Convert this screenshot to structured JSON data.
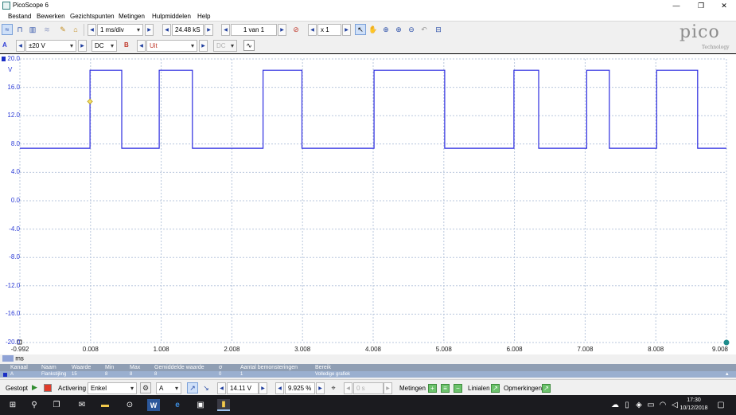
{
  "window": {
    "title": "PicoScope 6",
    "minimize": "—",
    "maximize": "❐",
    "close": "✕"
  },
  "menu": [
    "Bestand",
    "Bewerken",
    "Gezichtspunten",
    "Metingen",
    "Hulpmiddelen",
    "Help"
  ],
  "toolbar1": {
    "timebase": "1 ms/div",
    "samples": "24.48 kS",
    "capture": "1 van 1",
    "zoom": "x 1"
  },
  "toolbar2": {
    "channel_a_label": "A",
    "channel_a_range": "±20 V",
    "channel_a_coupling": "DC",
    "channel_b_label": "B",
    "channel_b_range": "Uit",
    "channel_b_coupling": "DC"
  },
  "logo": {
    "text": "pico",
    "subtext": "Technology"
  },
  "chart_data": {
    "type": "line",
    "ylabel": "V",
    "xlabel": "ms",
    "ylim": [
      -20,
      20
    ],
    "xlim": [
      -0.992,
      9.008
    ],
    "yticks": [
      "20.0",
      "16.0",
      "12.0",
      "8.0",
      "4.0",
      "0.0",
      "-4.0",
      "-8.0",
      "-12.0",
      "-16.0",
      "-20.0"
    ],
    "xticks": [
      "-0.992",
      "0.008",
      "1.008",
      "2.008",
      "3.008",
      "4.008",
      "5.008",
      "6.008",
      "7.008",
      "8.008",
      "9.008"
    ],
    "grid": true,
    "series": [
      {
        "name": "A",
        "color": "#2c2ce0",
        "x": [
          -0.992,
          0.0,
          0.0,
          0.45,
          0.45,
          0.98,
          0.98,
          1.45,
          1.45,
          2.45,
          2.45,
          3.0,
          3.0,
          4.02,
          4.02,
          5.02,
          5.02,
          6.0,
          6.0,
          6.35,
          6.35,
          7.03,
          7.03,
          7.35,
          7.35,
          8.02,
          8.02,
          8.6,
          8.6,
          9.008
        ],
        "y": [
          7.4,
          7.4,
          18.4,
          18.4,
          7.4,
          7.4,
          18.4,
          18.4,
          7.4,
          7.4,
          18.4,
          18.4,
          7.4,
          7.4,
          18.4,
          18.4,
          7.4,
          7.4,
          18.4,
          18.4,
          7.4,
          7.4,
          18.4,
          18.4,
          7.4,
          7.4,
          18.4,
          18.4,
          7.4,
          7.4
        ]
      }
    ],
    "trigger": {
      "x": 0.0,
      "y": 14.0
    }
  },
  "measurements": {
    "headers": [
      "Kanaal",
      "Naam",
      "Waarde",
      "Min",
      "Max",
      "Gemiddelde waarde",
      "σ",
      "Aantal bemonsteringen",
      "Bereik"
    ],
    "row": [
      "A",
      "Flankstijling",
      "15",
      "8",
      "8",
      "8",
      "0",
      "1",
      "Volledige grafiek"
    ]
  },
  "bottombar": {
    "status": "Gestopt",
    "trigger_label": "Activering",
    "trigger_mode": "Enkel",
    "trigger_channel": "A",
    "trigger_level": "14.11 V",
    "pre_trigger": "9.925 %",
    "delay": "0 s",
    "measurements_label": "Metingen",
    "rulers_label": "Linialen",
    "notes_label": "Opmerkingen"
  },
  "taskbar": {
    "time": "17:30",
    "date": "10/12/2018"
  }
}
